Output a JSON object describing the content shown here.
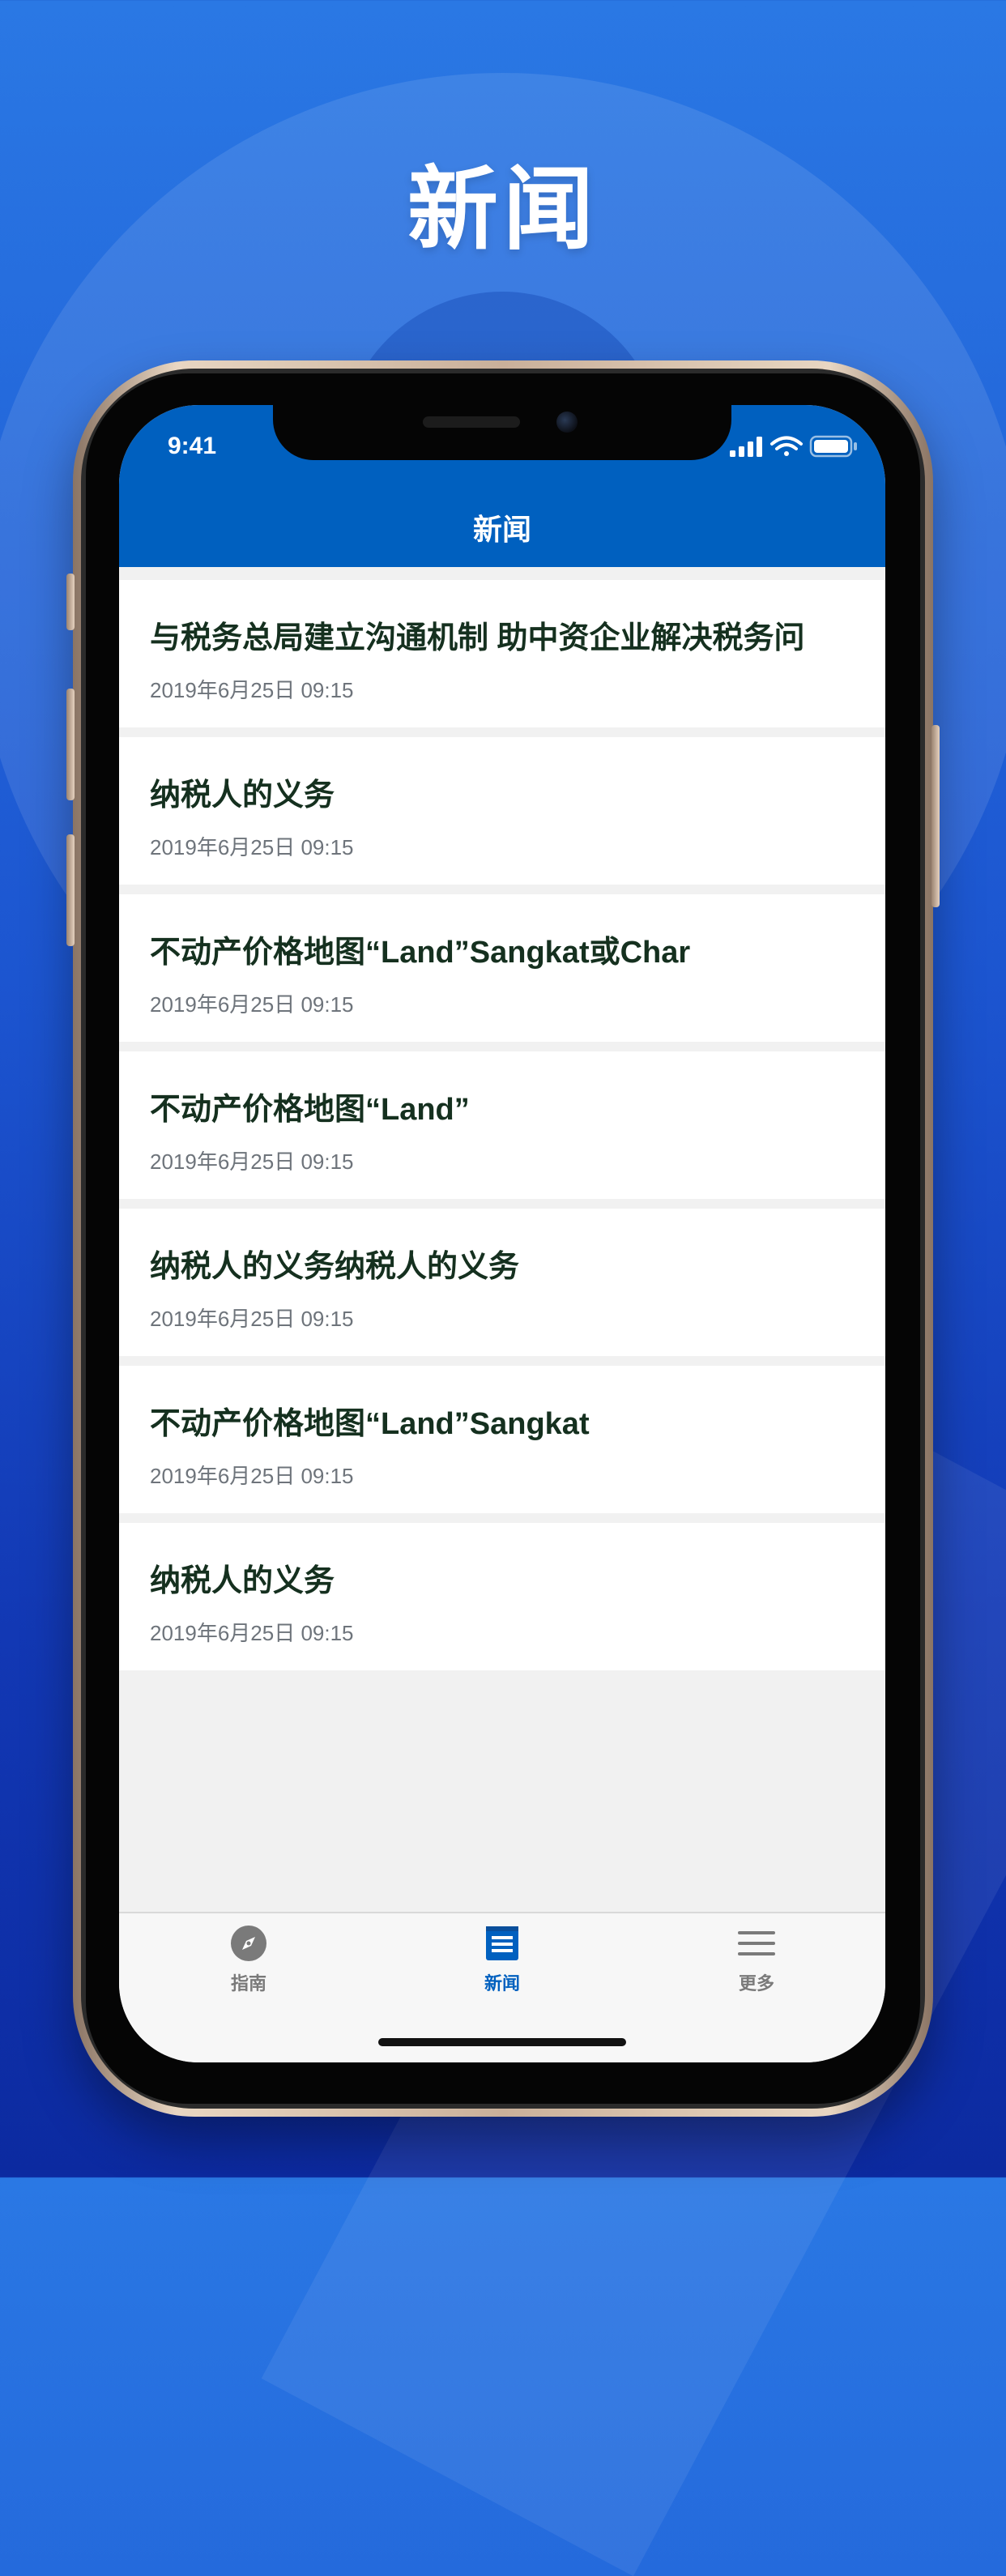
{
  "hero": {
    "title": "新闻"
  },
  "statusbar": {
    "time": "9:41"
  },
  "navbar": {
    "title": "新闻"
  },
  "news": [
    {
      "title": "与税务总局建立沟通机制 助中资企业解决税务问",
      "date": "2019年6月25日  09:15"
    },
    {
      "title": "纳税人的义务",
      "date": "2019年6月25日  09:15"
    },
    {
      "title": "不动产价格地图“Land”Sangkat或Char",
      "date": "2019年6月25日  09:15"
    },
    {
      "title": "不动产价格地图“Land”",
      "date": "2019年6月25日  09:15"
    },
    {
      "title": "纳税人的义务纳税人的义务",
      "date": "2019年6月25日  09:15"
    },
    {
      "title": "不动产价格地图“Land”Sangkat",
      "date": "2019年6月25日  09:15"
    },
    {
      "title": "纳税人的义务",
      "date": "2019年6月25日  09:15"
    }
  ],
  "tabbar": {
    "guide": {
      "label": "指南",
      "icon": "compass-icon"
    },
    "news": {
      "label": "新闻",
      "icon": "newspaper-icon",
      "active": true
    },
    "more": {
      "label": "更多",
      "icon": "menu-icon"
    }
  },
  "colors": {
    "accent": "#0060bf",
    "background": "#1c55d0"
  }
}
